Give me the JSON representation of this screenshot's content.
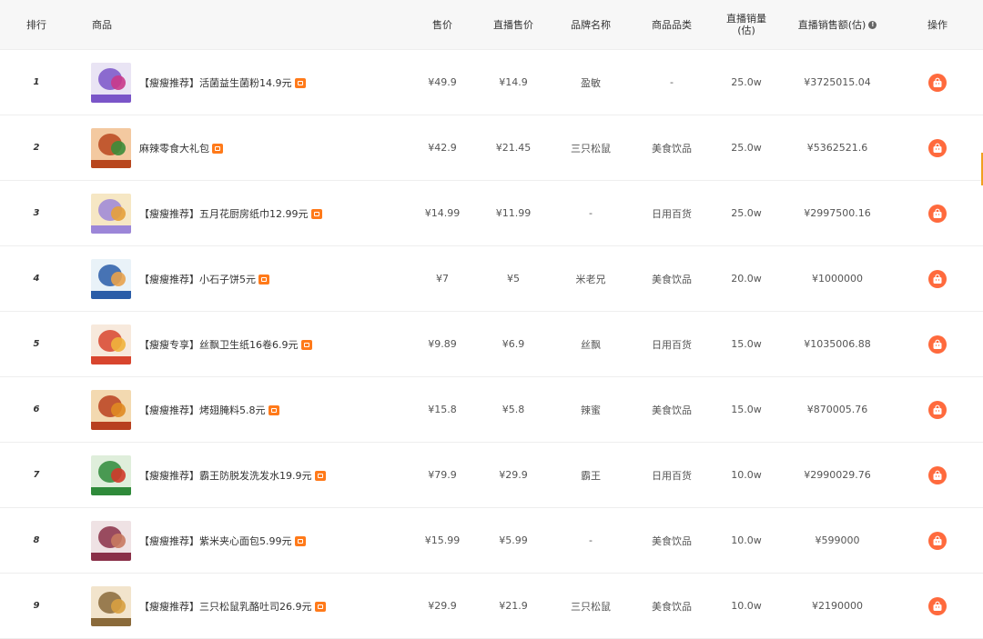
{
  "columns": {
    "rank": "排行",
    "product": "商品",
    "price": "售价",
    "live_price": "直播售价",
    "brand": "品牌名称",
    "category": "商品品类",
    "live_volume": "直播销量\n(估)",
    "live_amount": "直播销售额(估)",
    "action": "操作"
  },
  "colors": {
    "accent": "#ff6a3d",
    "tag": "#ff7a1a"
  },
  "rows": [
    {
      "rank": "1",
      "name": "【瘦瘦推荐】活菌益生菌粉14.9元",
      "price": "¥49.9",
      "live_price": "¥14.9",
      "brand": "盈敏",
      "category": "-",
      "volume": "25.0w",
      "amount": "¥3725015.04"
    },
    {
      "rank": "2",
      "name": "麻辣零食大礼包",
      "price": "¥42.9",
      "live_price": "¥21.45",
      "brand": "三只松鼠",
      "category": "美食饮品",
      "volume": "25.0w",
      "amount": "¥5362521.6"
    },
    {
      "rank": "3",
      "name": "【瘦瘦推荐】五月花厨房纸巾12.99元",
      "price": "¥14.99",
      "live_price": "¥11.99",
      "brand": "-",
      "category": "日用百货",
      "volume": "25.0w",
      "amount": "¥2997500.16"
    },
    {
      "rank": "4",
      "name": "【瘦瘦推荐】小石子饼5元",
      "price": "¥7",
      "live_price": "¥5",
      "brand": "米老兄",
      "category": "美食饮品",
      "volume": "20.0w",
      "amount": "¥1000000"
    },
    {
      "rank": "5",
      "name": "【瘦瘦专享】丝飘卫生纸16卷6.9元",
      "price": "¥9.89",
      "live_price": "¥6.9",
      "brand": "丝飘",
      "category": "日用百货",
      "volume": "15.0w",
      "amount": "¥1035006.88"
    },
    {
      "rank": "6",
      "name": "【瘦瘦推荐】烤翅腌料5.8元",
      "price": "¥15.8",
      "live_price": "¥5.8",
      "brand": "辣蜜",
      "category": "美食饮品",
      "volume": "15.0w",
      "amount": "¥870005.76"
    },
    {
      "rank": "7",
      "name": "【瘦瘦推荐】霸王防脱发洗发水19.9元",
      "price": "¥79.9",
      "live_price": "¥29.9",
      "brand": "霸王",
      "category": "日用百货",
      "volume": "10.0w",
      "amount": "¥2990029.76"
    },
    {
      "rank": "8",
      "name": "【瘦瘦推荐】紫米夹心面包5.99元",
      "price": "¥15.99",
      "live_price": "¥5.99",
      "brand": "-",
      "category": "美食饮品",
      "volume": "10.0w",
      "amount": "¥599000"
    },
    {
      "rank": "9",
      "name": "【瘦瘦推荐】三只松鼠乳酪吐司26.9元",
      "price": "¥29.9",
      "live_price": "¥21.9",
      "brand": "三只松鼠",
      "category": "美食饮品",
      "volume": "10.0w",
      "amount": "¥2190000"
    }
  ]
}
